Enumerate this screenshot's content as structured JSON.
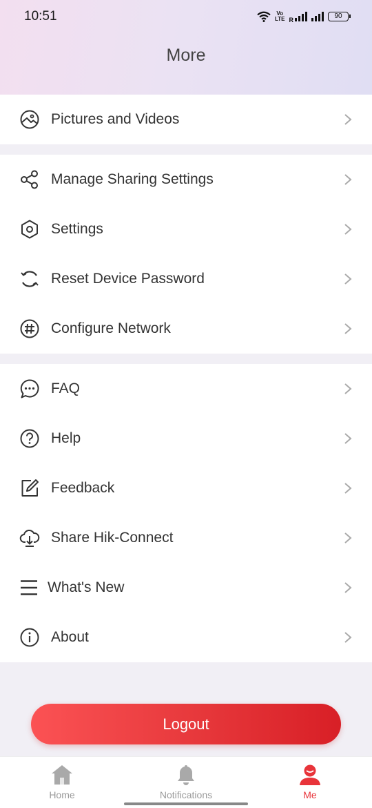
{
  "status_bar": {
    "time": "10:51",
    "volte_top": "Vo",
    "volte_bottom": "LTE",
    "roaming": "R",
    "battery": "90"
  },
  "header": {
    "title": "More"
  },
  "groups": [
    {
      "items": [
        {
          "label": "Pictures and Videos",
          "icon": "image-icon"
        }
      ]
    },
    {
      "items": [
        {
          "label": "Manage Sharing Settings",
          "icon": "share-icon"
        },
        {
          "label": "Settings",
          "icon": "hexagon-settings-icon"
        },
        {
          "label": "Reset Device Password",
          "icon": "reset-icon"
        },
        {
          "label": "Configure Network",
          "icon": "network-icon"
        }
      ]
    },
    {
      "items": [
        {
          "label": "FAQ",
          "icon": "chat-bubble-icon"
        },
        {
          "label": "Help",
          "icon": "question-circle-icon"
        },
        {
          "label": "Feedback",
          "icon": "edit-square-icon"
        },
        {
          "label": "Share Hik-Connect",
          "icon": "cloud-download-icon"
        },
        {
          "label": "What's New",
          "icon": "menu-lines-icon"
        },
        {
          "label": "About",
          "icon": "info-circle-icon"
        }
      ]
    }
  ],
  "logout_label": "Logout",
  "tabs": [
    {
      "label": "Home",
      "icon": "home-icon",
      "active": false
    },
    {
      "label": "Notifications",
      "icon": "bell-icon",
      "active": false
    },
    {
      "label": "Me",
      "icon": "person-icon",
      "active": true
    }
  ],
  "colors": {
    "accent": "#e8343a",
    "inactive_tab": "#9a9a9a",
    "background": "#f1eff5"
  }
}
